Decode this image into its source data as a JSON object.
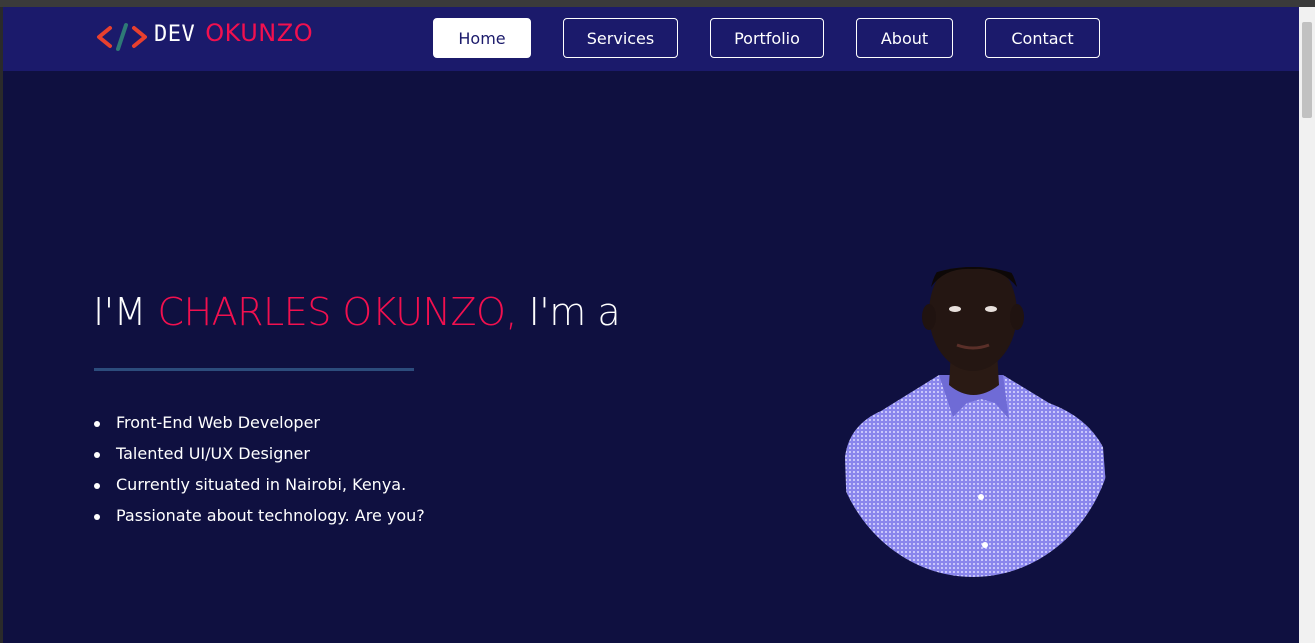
{
  "brand": {
    "first": "DEV",
    "second": "OKUNZO",
    "icon": "code-brackets-icon"
  },
  "nav": {
    "items": [
      {
        "label": "Home",
        "active": true
      },
      {
        "label": "Services",
        "active": false
      },
      {
        "label": "Portfolio",
        "active": false
      },
      {
        "label": "About",
        "active": false
      },
      {
        "label": "Contact",
        "active": false
      }
    ]
  },
  "hero": {
    "intro": "I'M ",
    "name": "CHARLES OKUNZO,",
    "suffix": " I'm a",
    "bullets": [
      "Front-End Web Developer",
      "Talented UI/UX Designer",
      "Currently situated in Nairobi, Kenya.",
      "Passionate about technology. Are you?"
    ],
    "portrait": "person-portrait"
  },
  "colors": {
    "background": "#0f1040",
    "navbar": "#1b1a6b",
    "accent": "#f2104f",
    "divider": "#2c4c7c"
  }
}
